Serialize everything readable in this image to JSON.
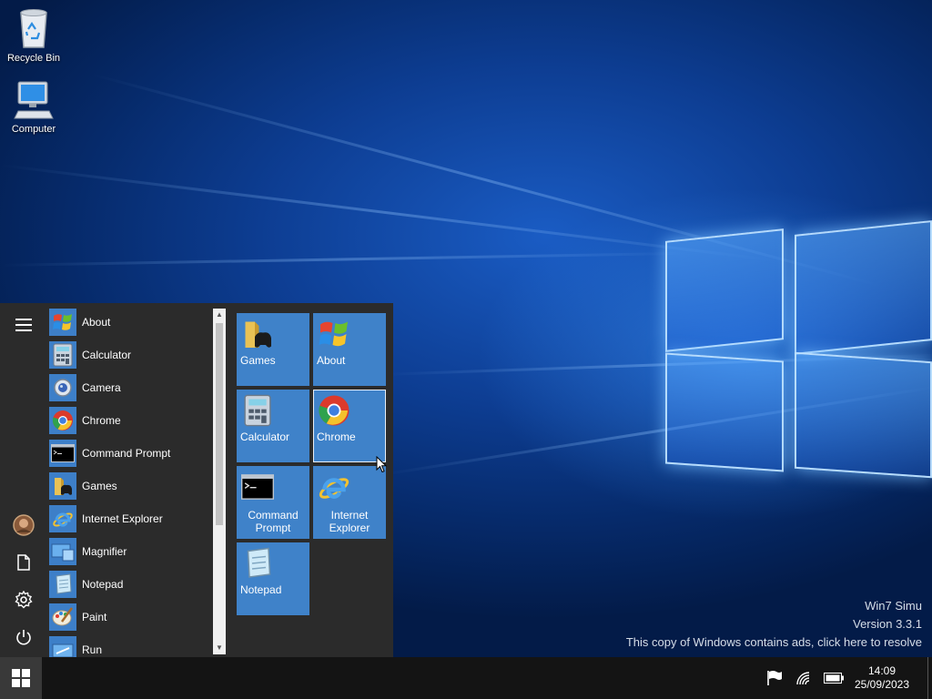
{
  "desktop": {
    "icons": [
      {
        "label": "Recycle Bin",
        "icon": "recycle-bin-icon"
      },
      {
        "label": "Computer",
        "icon": "computer-icon"
      }
    ]
  },
  "watermark": {
    "line1": "Win7 Simu",
    "line2": "Version 3.3.1",
    "line3": "This copy of Windows contains ads, click here to resolve"
  },
  "start_menu": {
    "rail": [
      "hamburger-menu-icon",
      "user-avatar-icon",
      "documents-icon",
      "settings-gear-icon",
      "power-icon"
    ],
    "apps": [
      {
        "label": "About",
        "icon": "windows-flag-icon"
      },
      {
        "label": "Calculator",
        "icon": "calculator-icon"
      },
      {
        "label": "Camera",
        "icon": "camera-icon"
      },
      {
        "label": "Chrome",
        "icon": "chrome-icon"
      },
      {
        "label": "Command Prompt",
        "icon": "command-prompt-icon"
      },
      {
        "label": "Games",
        "icon": "games-folder-icon"
      },
      {
        "label": "Internet Explorer",
        "icon": "internet-explorer-icon"
      },
      {
        "label": "Magnifier",
        "icon": "magnifier-icon"
      },
      {
        "label": "Notepad",
        "icon": "notepad-icon"
      },
      {
        "label": "Paint",
        "icon": "paint-icon"
      },
      {
        "label": "Run",
        "icon": "run-icon"
      }
    ],
    "tiles": [
      {
        "label": "Games",
        "icon": "games-folder-icon"
      },
      {
        "label": "About",
        "icon": "windows-flag-icon"
      },
      {
        "label": "Calculator",
        "icon": "calculator-icon"
      },
      {
        "label": "Chrome",
        "icon": "chrome-icon",
        "selected": true
      },
      {
        "label_line1": "Command",
        "label_line2": "Prompt",
        "icon": "command-prompt-icon"
      },
      {
        "label_line1": "Internet",
        "label_line2": "Explorer",
        "icon": "internet-explorer-icon"
      },
      {
        "label": "Notepad",
        "icon": "notepad-icon"
      }
    ]
  },
  "taskbar": {
    "tray_icons": [
      "action-center-flag-icon",
      "wifi-icon",
      "battery-icon"
    ],
    "time": "14:09",
    "date": "25/09/2023"
  },
  "colors": {
    "tile_blue": "#3f82c9",
    "start_menu_bg": "#2b2b2b",
    "taskbar_bg": "#141414"
  }
}
